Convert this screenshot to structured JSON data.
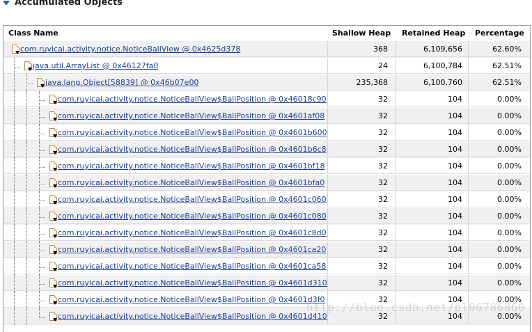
{
  "section": {
    "title": "Accumulated Objects"
  },
  "columns": {
    "class_name": "Class Name",
    "shallow_heap": "Shallow Heap",
    "retained_heap": "Retained Heap",
    "percentage": "Percentage"
  },
  "rows": [
    {
      "name": "com.ruyicai.activity.notice.NoticeBallView @ 0x4625d378",
      "shallow": "368",
      "retained": "6,109,656",
      "pct": "62.60%",
      "depth": 0
    },
    {
      "name": "java.util.ArrayList @ 0x46127fa0",
      "shallow": "24",
      "retained": "6,100,784",
      "pct": "62.51%",
      "depth": 1
    },
    {
      "name": "java.lang.Object[58839] @ 0x46b07e00",
      "shallow": "235,368",
      "retained": "6,100,760",
      "pct": "62.51%",
      "depth": 2
    },
    {
      "name": "com.ruyicai.activity.notice.NoticeBallView$BallPosition @ 0x46018c90",
      "shallow": "32",
      "retained": "104",
      "pct": "0.00%",
      "depth": 3
    },
    {
      "name": "com.ruyicai.activity.notice.NoticeBallView$BallPosition @ 0x4601af08",
      "shallow": "32",
      "retained": "104",
      "pct": "0.00%",
      "depth": 3
    },
    {
      "name": "com.ruyicai.activity.notice.NoticeBallView$BallPosition @ 0x4601b600",
      "shallow": "32",
      "retained": "104",
      "pct": "0.00%",
      "depth": 3
    },
    {
      "name": "com.ruyicai.activity.notice.NoticeBallView$BallPosition @ 0x4601b6c8",
      "shallow": "32",
      "retained": "104",
      "pct": "0.00%",
      "depth": 3
    },
    {
      "name": "com.ruyicai.activity.notice.NoticeBallView$BallPosition @ 0x4601bf18",
      "shallow": "32",
      "retained": "104",
      "pct": "0.00%",
      "depth": 3
    },
    {
      "name": "com.ruyicai.activity.notice.NoticeBallView$BallPosition @ 0x4601bfa0",
      "shallow": "32",
      "retained": "104",
      "pct": "0.00%",
      "depth": 3
    },
    {
      "name": "com.ruyicai.activity.notice.NoticeBallView$BallPosition @ 0x4601c060",
      "shallow": "32",
      "retained": "104",
      "pct": "0.00%",
      "depth": 3
    },
    {
      "name": "com.ruyicai.activity.notice.NoticeBallView$BallPosition @ 0x4601c080",
      "shallow": "32",
      "retained": "104",
      "pct": "0.00%",
      "depth": 3
    },
    {
      "name": "com.ruyicai.activity.notice.NoticeBallView$BallPosition @ 0x4601c8d0",
      "shallow": "32",
      "retained": "104",
      "pct": "0.00%",
      "depth": 3
    },
    {
      "name": "com.ruyicai.activity.notice.NoticeBallView$BallPosition @ 0x4601ca20",
      "shallow": "32",
      "retained": "104",
      "pct": "0.00%",
      "depth": 3
    },
    {
      "name": "com.ruyicai.activity.notice.NoticeBallView$BallPosition @ 0x4601ca58",
      "shallow": "32",
      "retained": "104",
      "pct": "0.00%",
      "depth": 3
    },
    {
      "name": "com.ruyicai.activity.notice.NoticeBallView$BallPosition @ 0x4601d310",
      "shallow": "32",
      "retained": "104",
      "pct": "0.00%",
      "depth": 3
    },
    {
      "name": "com.ruyicai.activity.notice.NoticeBallView$BallPosition @ 0x4601d3f0",
      "shallow": "32",
      "retained": "104",
      "pct": "0.00%",
      "depth": 3
    },
    {
      "name": "com.ruyicai.activity.notice.NoticeBallView$BallPosition @ 0x4601d410",
      "shallow": "32",
      "retained": "104",
      "pct": "0.00%",
      "depth": 3
    }
  ],
  "watermark": "http://blog.csdn.net/pl06786860",
  "colors": {
    "link": "#1a3f99",
    "twisty": "#2f5f9a",
    "row_alt": "#f0f0f0"
  },
  "icons": {
    "twisty": "triangle-down-icon",
    "row": "class-file-icon"
  }
}
